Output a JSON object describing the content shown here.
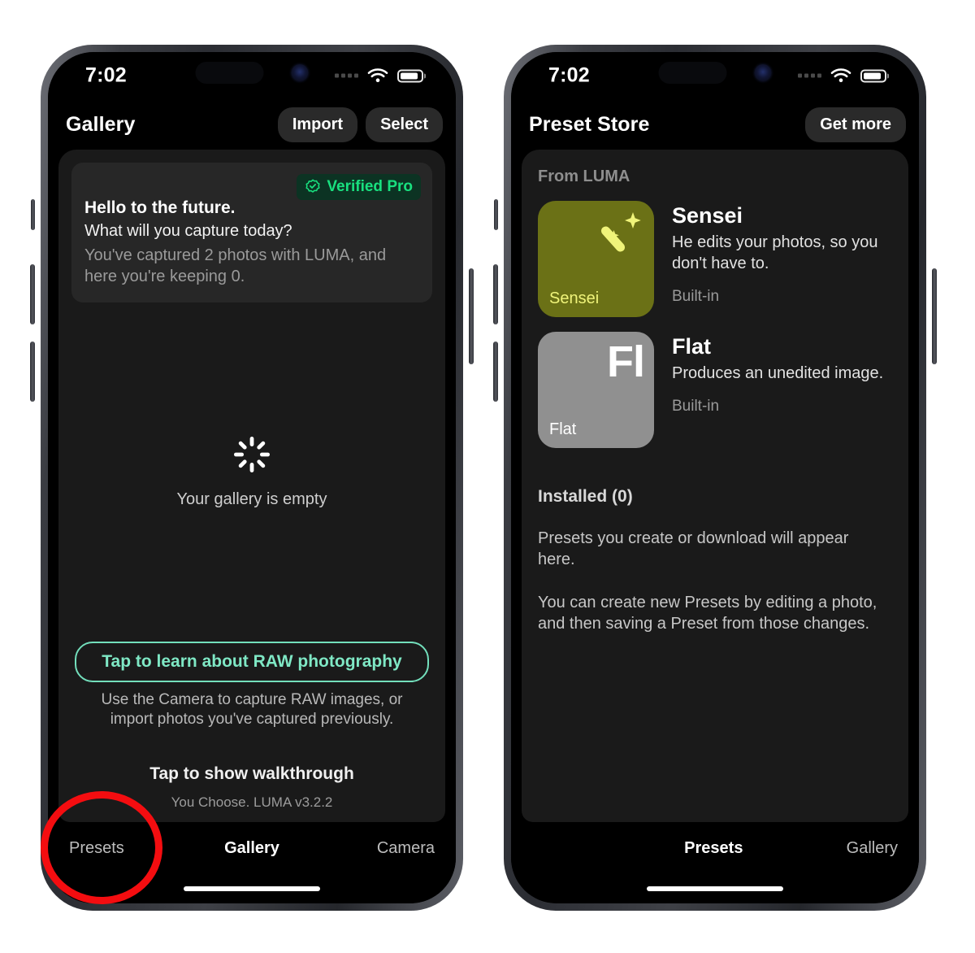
{
  "annotation": {
    "shape": "ellipse",
    "color": "#f40d10",
    "target": "presets-tab-left-phone"
  },
  "left_phone": {
    "status_bar": {
      "time": "7:02",
      "cellular_icon": "cellular-dots-icon",
      "wifi_icon": "wifi-icon",
      "battery_icon": "battery-icon"
    },
    "nav": {
      "title": "Gallery",
      "import_label": "Import",
      "select_label": "Select"
    },
    "hero": {
      "badge_label": "Verified Pro",
      "badge_icon": "verified-rosette-icon",
      "heading": "Hello to the future.",
      "subheading": "What will you capture today?",
      "body": "You've captured 2 photos with LUMA, and here you're keeping 0."
    },
    "empty_state": {
      "spinner_icon": "spinner-icon",
      "label": "Your gallery is empty"
    },
    "footer": {
      "raw_button": "Tap to learn about RAW photography",
      "raw_help": "Use the Camera to capture RAW images, or import photos you've captured previously.",
      "walkthrough": "Tap to show walkthrough",
      "version": "You Choose. LUMA v3.2.2"
    },
    "tabs": [
      {
        "label": "Presets",
        "active": false
      },
      {
        "label": "Gallery",
        "active": true
      },
      {
        "label": "Camera",
        "active": false
      }
    ]
  },
  "right_phone": {
    "status_bar": {
      "time": "7:02",
      "cellular_icon": "cellular-dots-icon",
      "wifi_icon": "wifi-icon",
      "battery_icon": "battery-icon"
    },
    "nav": {
      "title": "Preset Store",
      "get_more_label": "Get more"
    },
    "from_luma_label": "From LUMA",
    "presets": [
      {
        "tile_label": "Sensei",
        "tile_icon": "magic-wand-sparkle-icon",
        "tile_color": "#6b7116",
        "title": "Sensei",
        "description": "He edits your photos, so you don't have to.",
        "meta": "Built-in"
      },
      {
        "tile_label": "Flat",
        "tile_glyph": "Fl",
        "tile_color": "#909090",
        "title": "Flat",
        "description": "Produces an unedited image.",
        "meta": "Built-in"
      }
    ],
    "installed": {
      "label": "Installed (0)",
      "line1": "Presets you create or download will appear here.",
      "line2": "You can create new Presets by editing a photo, and then saving a Preset from those changes."
    },
    "tabs": [
      {
        "label": "Presets",
        "active": true
      },
      {
        "label": "Gallery",
        "active": false
      }
    ]
  },
  "colors": {
    "accent_mint": "#7fe8c5",
    "verified_green": "#19e07f",
    "annotation_red": "#f40d10",
    "sensei_olive": "#6b7116",
    "flat_gray": "#909090"
  }
}
